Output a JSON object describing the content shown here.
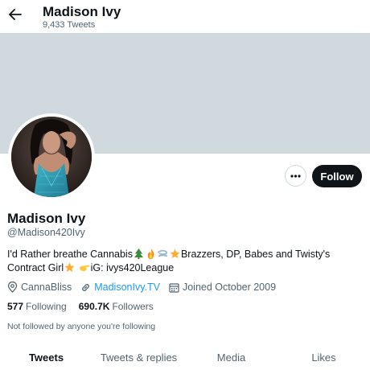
{
  "header": {
    "title": "Madison Ivy",
    "tweet_count": "9,433 Tweets"
  },
  "profile": {
    "name": "Madison Ivy",
    "handle": "@Madison420Ivy",
    "follow_label": "Follow",
    "bio": {
      "part1": "I'd Rather breathe Cannabis",
      "part2": "Brazzers, DP, Babes and Twisty's Contract Girl",
      "part3": "iG: ivys420League"
    },
    "location": "CannaBliss",
    "website": "MadisonIvy.TV",
    "joined": "Joined October 2009",
    "following_count": "577",
    "following_label": "Following",
    "followers_count": "690.7K",
    "followers_label": "Followers",
    "not_followed_text": "Not followed by anyone you're following"
  },
  "tabs": [
    {
      "label": "Tweets",
      "active": true
    },
    {
      "label": "Tweets & replies",
      "active": false
    },
    {
      "label": "Media",
      "active": false
    },
    {
      "label": "Likes",
      "active": false
    }
  ],
  "colors": {
    "banner": "#cfd9de",
    "link": "#1d9bf0",
    "follow_bg": "#0f1419",
    "secondary_text": "#536471"
  },
  "icons": [
    "back-arrow-icon",
    "more-icon",
    "location-icon",
    "link-icon",
    "calendar-icon",
    "tree-emoji",
    "fire-emoji",
    "wind-emoji",
    "star-emoji",
    "pointing-hand-emoji"
  ]
}
